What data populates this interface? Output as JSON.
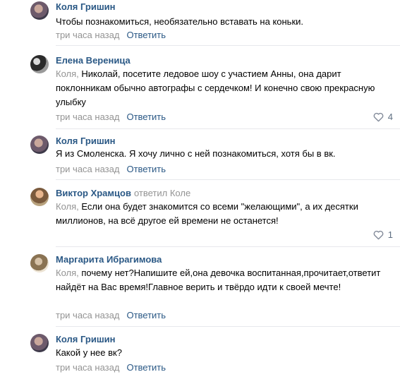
{
  "comments": [
    {
      "author": "Коля Гришин",
      "reply_to": "",
      "addressee": "",
      "text": "Чтобы познакомиться, необязательно вставать на коньки.",
      "time": "три часа назад",
      "reply_label": "Ответить",
      "likes": ""
    },
    {
      "author": "Елена Вереница",
      "reply_to": "",
      "addressee": "Коля,",
      "text": "Николай, посетите ледовое шоу с участием Анны, она дарит поклонникам обычно автографы с сердечком! И конечно свою прекрасную улыбку",
      "time": "три часа назад",
      "reply_label": "Ответить",
      "likes": "4"
    },
    {
      "author": "Коля Гришин",
      "reply_to": "",
      "addressee": "",
      "text": "Я из Смоленска. Я хочу лично с ней познакомиться, хотя бы в вк.",
      "time": "три часа назад",
      "reply_label": "Ответить",
      "likes": ""
    },
    {
      "author": "Виктор Храмцов",
      "reply_to": "ответил Коле",
      "addressee": "Коля,",
      "text": "Если она будет знакомится со всеми \"желающими\", а их десятки миллионов, на всё другое ей времени не останется!",
      "time": "",
      "reply_label": "",
      "likes": "1"
    },
    {
      "author": "Маргарита Ибрагимова",
      "reply_to": "",
      "addressee": "Коля,",
      "text": "почему нет?Напишите ей,она девочка воспитанная,прочитает,ответит найдёт на Вас время!Главное верить и твёрдо идти к своей мечте!",
      "time": "три часа назад",
      "reply_label": "Ответить",
      "likes": ""
    },
    {
      "author": "Коля Гришин",
      "reply_to": "",
      "addressee": "",
      "text": "Какой у нее вк?",
      "time": "три часа назад",
      "reply_label": "Ответить",
      "likes": ""
    }
  ],
  "icons": {
    "like": "heart-icon"
  },
  "colors": {
    "link": "#2a5885",
    "muted": "#939393",
    "divider": "#e7e8ec"
  }
}
